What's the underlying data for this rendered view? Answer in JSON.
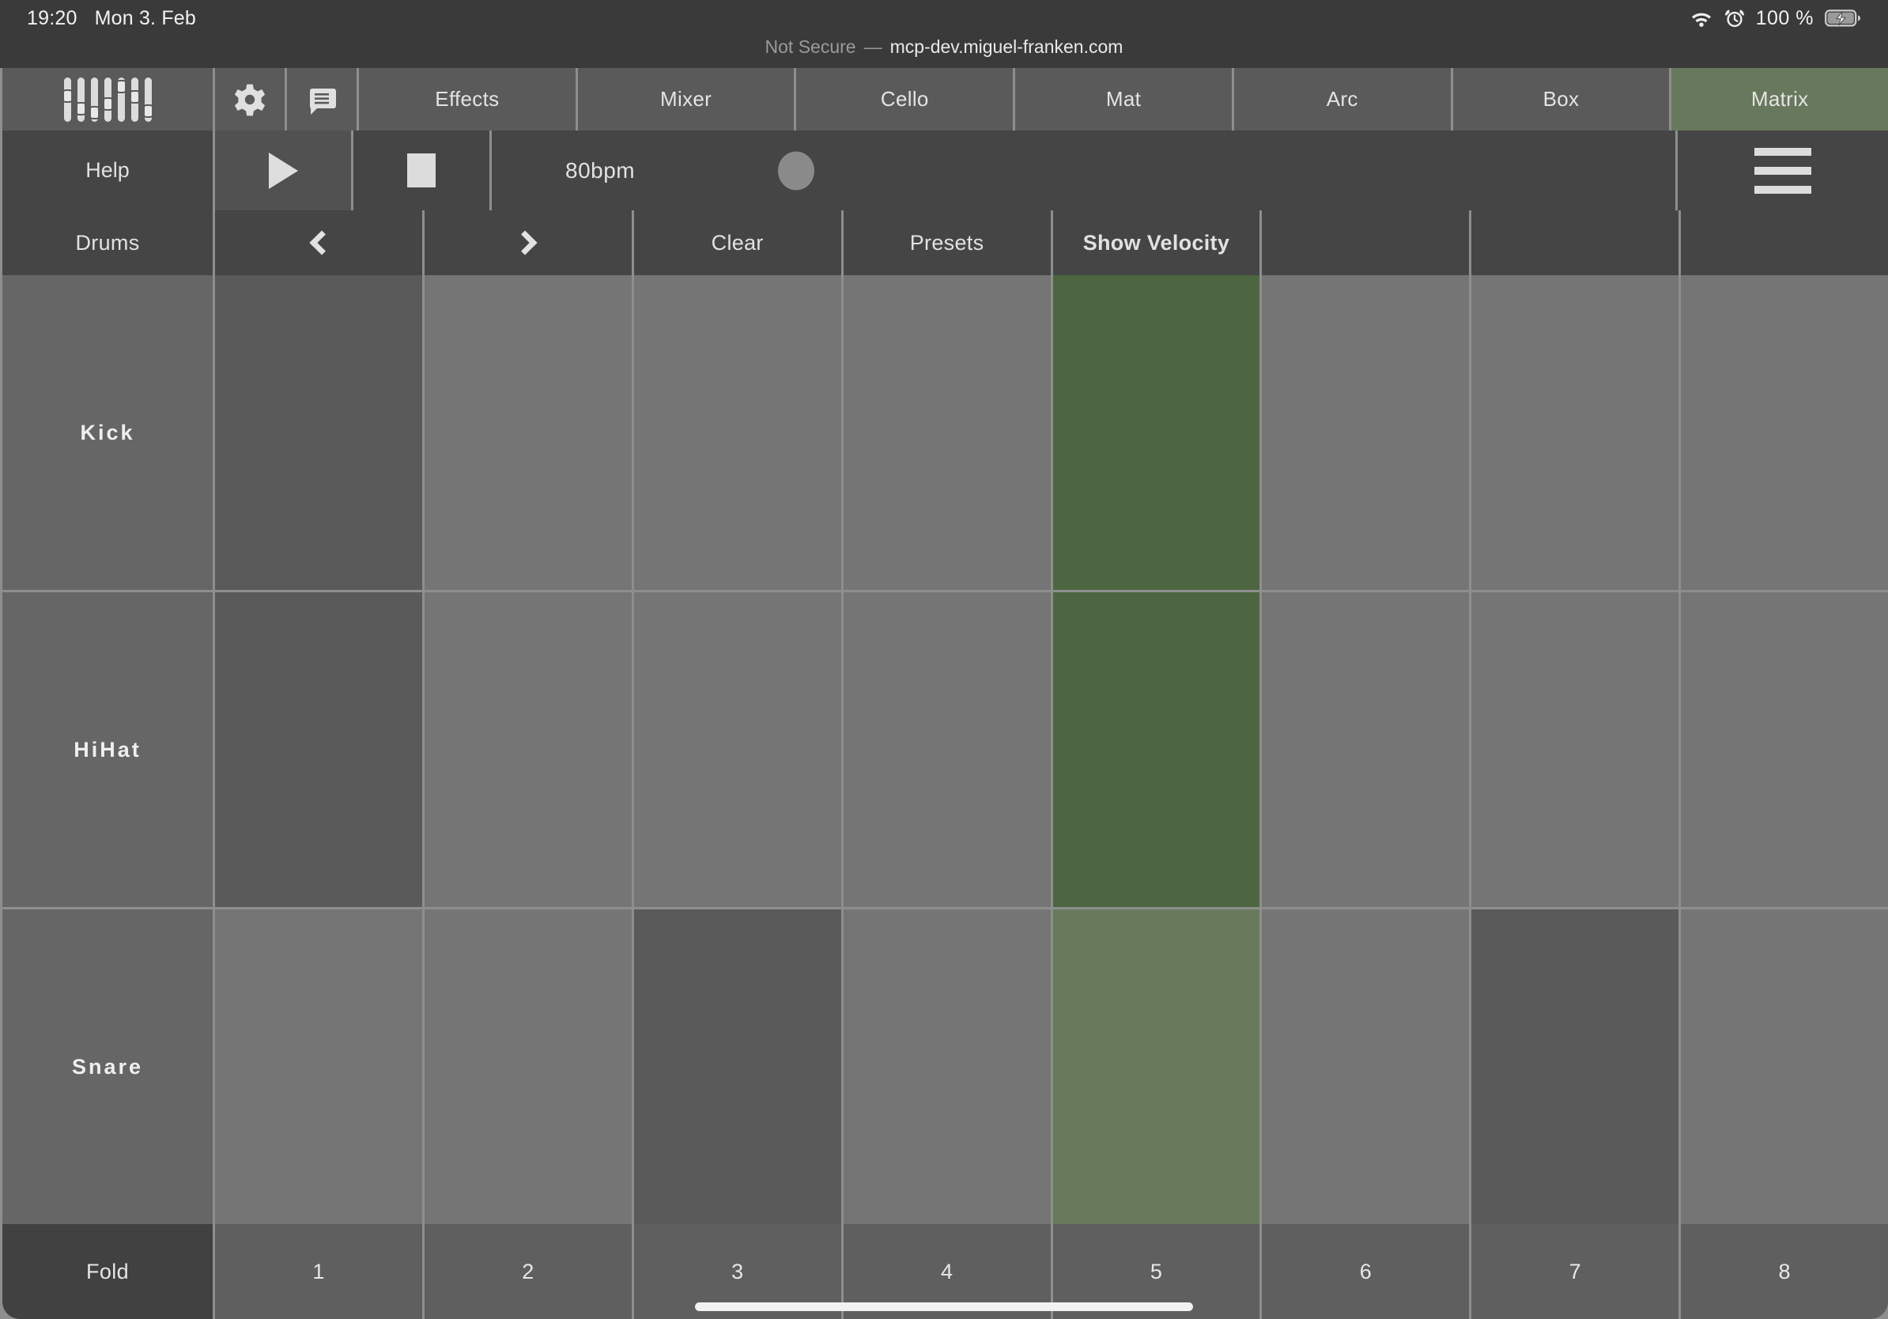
{
  "statusbar": {
    "time": "19:20",
    "date": "Mon 3. Feb",
    "wifi_icon": "wifi-icon",
    "alarm_icon": "alarm-clock-icon",
    "battery_percent": "100 %",
    "battery_icon": "battery-charging-icon"
  },
  "urlbar": {
    "security_label": "Not Secure",
    "separator": "—",
    "host": "mcp-dev.miguel-franken.com"
  },
  "navbar": {
    "logo_icon": "faders-logo-icon",
    "settings_icon": "gear-icon",
    "messages_icon": "chat-bubble-icon",
    "tabs": [
      {
        "label": "Effects",
        "active": false
      },
      {
        "label": "Mixer",
        "active": false
      },
      {
        "label": "Cello",
        "active": false
      },
      {
        "label": "Mat",
        "active": false
      },
      {
        "label": "Arc",
        "active": false
      },
      {
        "label": "Box",
        "active": false
      },
      {
        "label": "Matrix",
        "active": true
      }
    ]
  },
  "transport": {
    "help_label": "Help",
    "play_icon": "play-icon",
    "stop_icon": "stop-icon",
    "tempo": "80bpm",
    "tempo_knob_icon": "tempo-knob",
    "menu_icon": "hamburger-menu-icon"
  },
  "toolbar": {
    "instrument": "Drums",
    "prev_icon": "chevron-left-icon",
    "next_icon": "chevron-right-icon",
    "clear_label": "Clear",
    "presets_label": "Presets",
    "show_velocity_label": "Show Velocity",
    "empty_cells": 3
  },
  "matrix": {
    "rows": [
      {
        "label": "Kick",
        "cells": [
          "dark",
          "light",
          "light",
          "light",
          "on",
          "light",
          "light",
          "light"
        ]
      },
      {
        "label": "HiHat",
        "cells": [
          "dark",
          "light",
          "light",
          "light",
          "on",
          "light",
          "light",
          "light"
        ]
      },
      {
        "label": "Snare",
        "cells": [
          "light",
          "light",
          "dark",
          "light",
          "on-soft",
          "light",
          "dark",
          "light"
        ]
      }
    ]
  },
  "footer": {
    "fold_label": "Fold",
    "steps": [
      "1",
      "2",
      "3",
      "4",
      "5",
      "6",
      "7",
      "8"
    ]
  },
  "colors": {
    "accent_green": "#4d6540",
    "accent_green_soft": "#687a5b",
    "tab_active_green": "#68785d",
    "cell_light": "#757575",
    "cell_dark": "#5a5a5a",
    "chrome_dark": "#3a3a3a",
    "grid_line": "#8d8f8d"
  }
}
